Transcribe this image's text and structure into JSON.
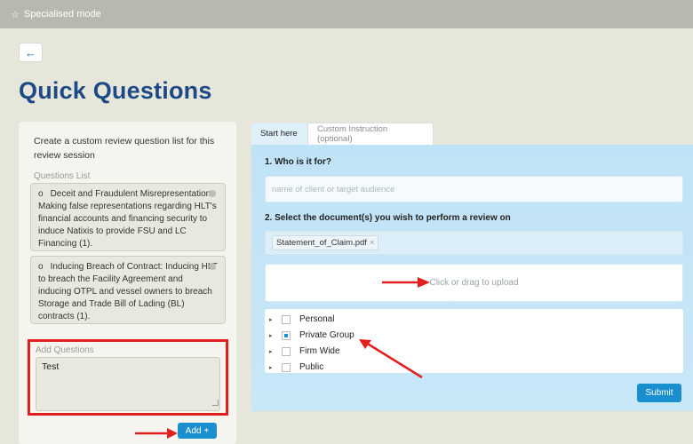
{
  "topbar": {
    "icon": "star-icon",
    "label": "Specialised mode"
  },
  "back": {
    "icon": "arrow-left-icon",
    "glyph": "←"
  },
  "page": {
    "title": "Quick Questions"
  },
  "left": {
    "intro": "Create a custom review question list for this review session",
    "list_title": "Questions List",
    "questions": [
      {
        "bullet": "o",
        "text": "Deceit and Fraudulent Misrepresentation: Making false representations regarding HLT's financial accounts and financing security to induce Natixis to provide FSU and LC Financing (1)."
      },
      {
        "bullet": "o",
        "text": "Inducing Breach of Contract: Inducing HLT to breach the Facility Agreement and inducing OTPL and vessel owners to breach Storage and Trade Bill of Lading (BL) contracts (1)."
      }
    ],
    "add_label": "Add Questions",
    "add_value": "Test",
    "add_button": "Add +"
  },
  "right": {
    "tabs": [
      {
        "label": "Start here",
        "active": true
      },
      {
        "label": "Custom Instruction (optional)",
        "active": false
      }
    ],
    "q1_label": "1. Who is it for?",
    "q1_placeholder": "name of client or target audience",
    "q2_label": "2. Select the document(s) you wish to perform a review on",
    "document_chip": "Statement_of_Claim.pdf",
    "chip_remove": "×",
    "upload_text": "Click or drag to upload",
    "tree": [
      {
        "label": "Personal",
        "checked": false
      },
      {
        "label": "Private Group",
        "checked": "partial"
      },
      {
        "label": "Firm Wide",
        "checked": false
      },
      {
        "label": "Public",
        "checked": false
      }
    ],
    "submit": "Submit"
  },
  "colors": {
    "accent": "#1a8fcf",
    "title": "#1d4a86",
    "highlight": "#e02020"
  }
}
